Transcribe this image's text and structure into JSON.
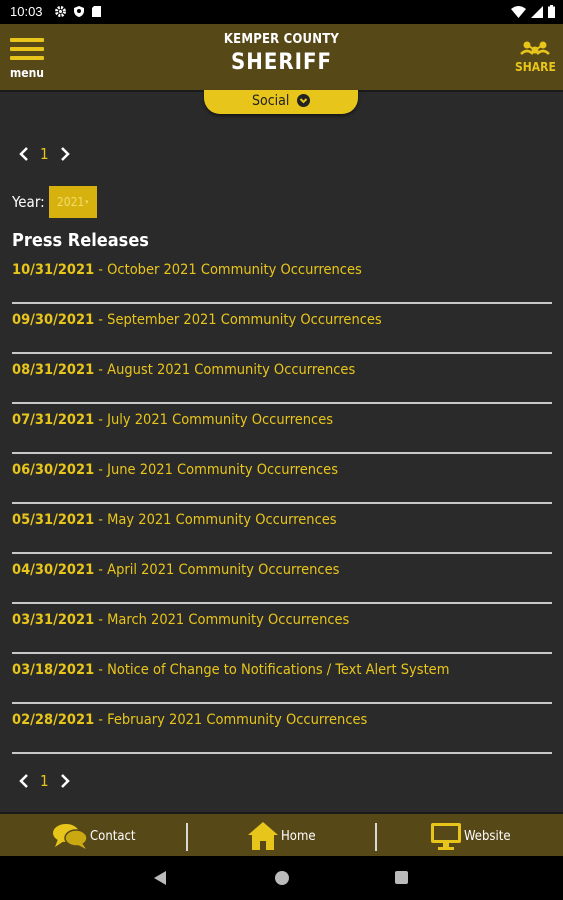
{
  "status_bar": {
    "time": "10:03"
  },
  "header": {
    "menu_label": "menu",
    "title_top": "KEMPER COUNTY",
    "title_main": "SHERIFF",
    "share_label": "SHARE"
  },
  "social_tab": {
    "label": "Social"
  },
  "pagination": {
    "page": "1"
  },
  "year_filter": {
    "label": "Year:",
    "selected": "2021"
  },
  "section_title": "Press Releases",
  "press_releases": [
    {
      "date": "10/31/2021",
      "title": "October 2021 Community Occurrences"
    },
    {
      "date": "09/30/2021",
      "title": "September 2021 Community Occurrences"
    },
    {
      "date": "08/31/2021",
      "title": "August 2021 Community Occurrences"
    },
    {
      "date": "07/31/2021",
      "title": "July 2021 Community Occurrences"
    },
    {
      "date": "06/30/2021",
      "title": "June 2021 Community Occurrences"
    },
    {
      "date": "05/31/2021",
      "title": "May 2021 Community Occurrences"
    },
    {
      "date": "04/30/2021",
      "title": "April 2021 Community Occurrences"
    },
    {
      "date": "03/31/2021",
      "title": "March 2021 Community Occurrences"
    },
    {
      "date": "03/18/2021",
      "title": "Notice of Change to Notifications / Text Alert System"
    },
    {
      "date": "02/28/2021",
      "title": "February 2021 Community Occurrences"
    }
  ],
  "bottom_nav": {
    "contact": "Contact",
    "home": "Home",
    "website": "Website"
  },
  "colors": {
    "accent": "#e8c51b",
    "header_bg": "#574818",
    "page_bg": "#2a2a2a"
  }
}
